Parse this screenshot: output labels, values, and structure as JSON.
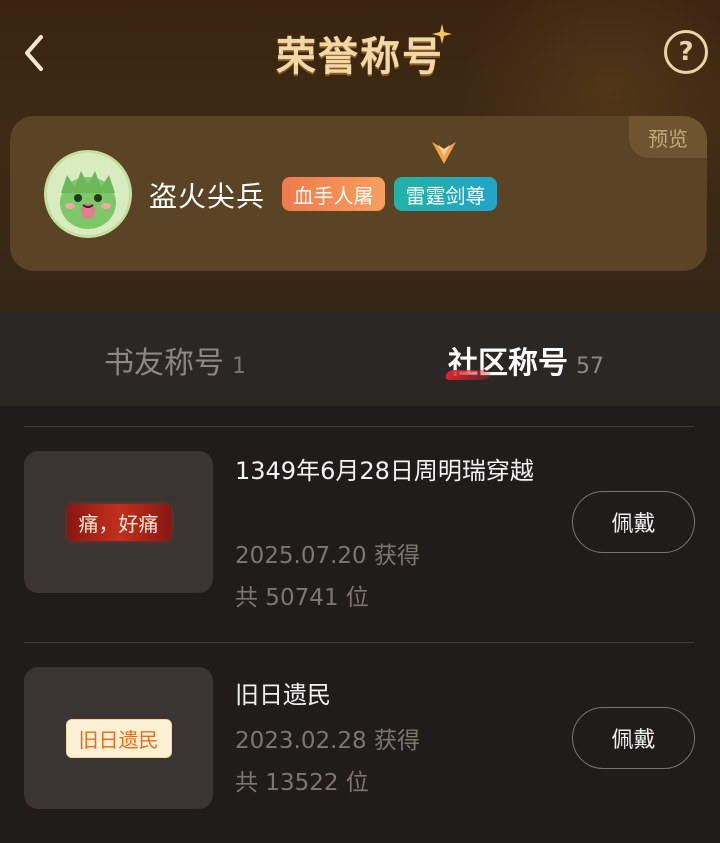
{
  "header": {
    "title": "荣誉称号",
    "help_label": "?"
  },
  "preview": {
    "tag": "预览",
    "username": "盗火尖兵",
    "badges": [
      "血手人屠",
      "雷霆剑尊"
    ]
  },
  "tabs": [
    {
      "label": "书友称号",
      "count": "1"
    },
    {
      "label": "社区称号",
      "count": "57"
    }
  ],
  "items": [
    {
      "thumb_text": "痛，好痛",
      "title": "1349年6月28日周明瑞穿越",
      "date": "2025.07.20 获得",
      "total": "共 50741 位",
      "button": "佩戴"
    },
    {
      "thumb_text": "旧日遗民",
      "title": "旧日遗民",
      "date": "2023.02.28 获得",
      "total": "共 13522 位",
      "button": "佩戴"
    }
  ],
  "colors": {
    "title_gold": "#f1d8a6",
    "badge_orange": "#f07a4b",
    "badge_teal": "#22b3a5",
    "tab_active_underline": "#d8262e"
  }
}
